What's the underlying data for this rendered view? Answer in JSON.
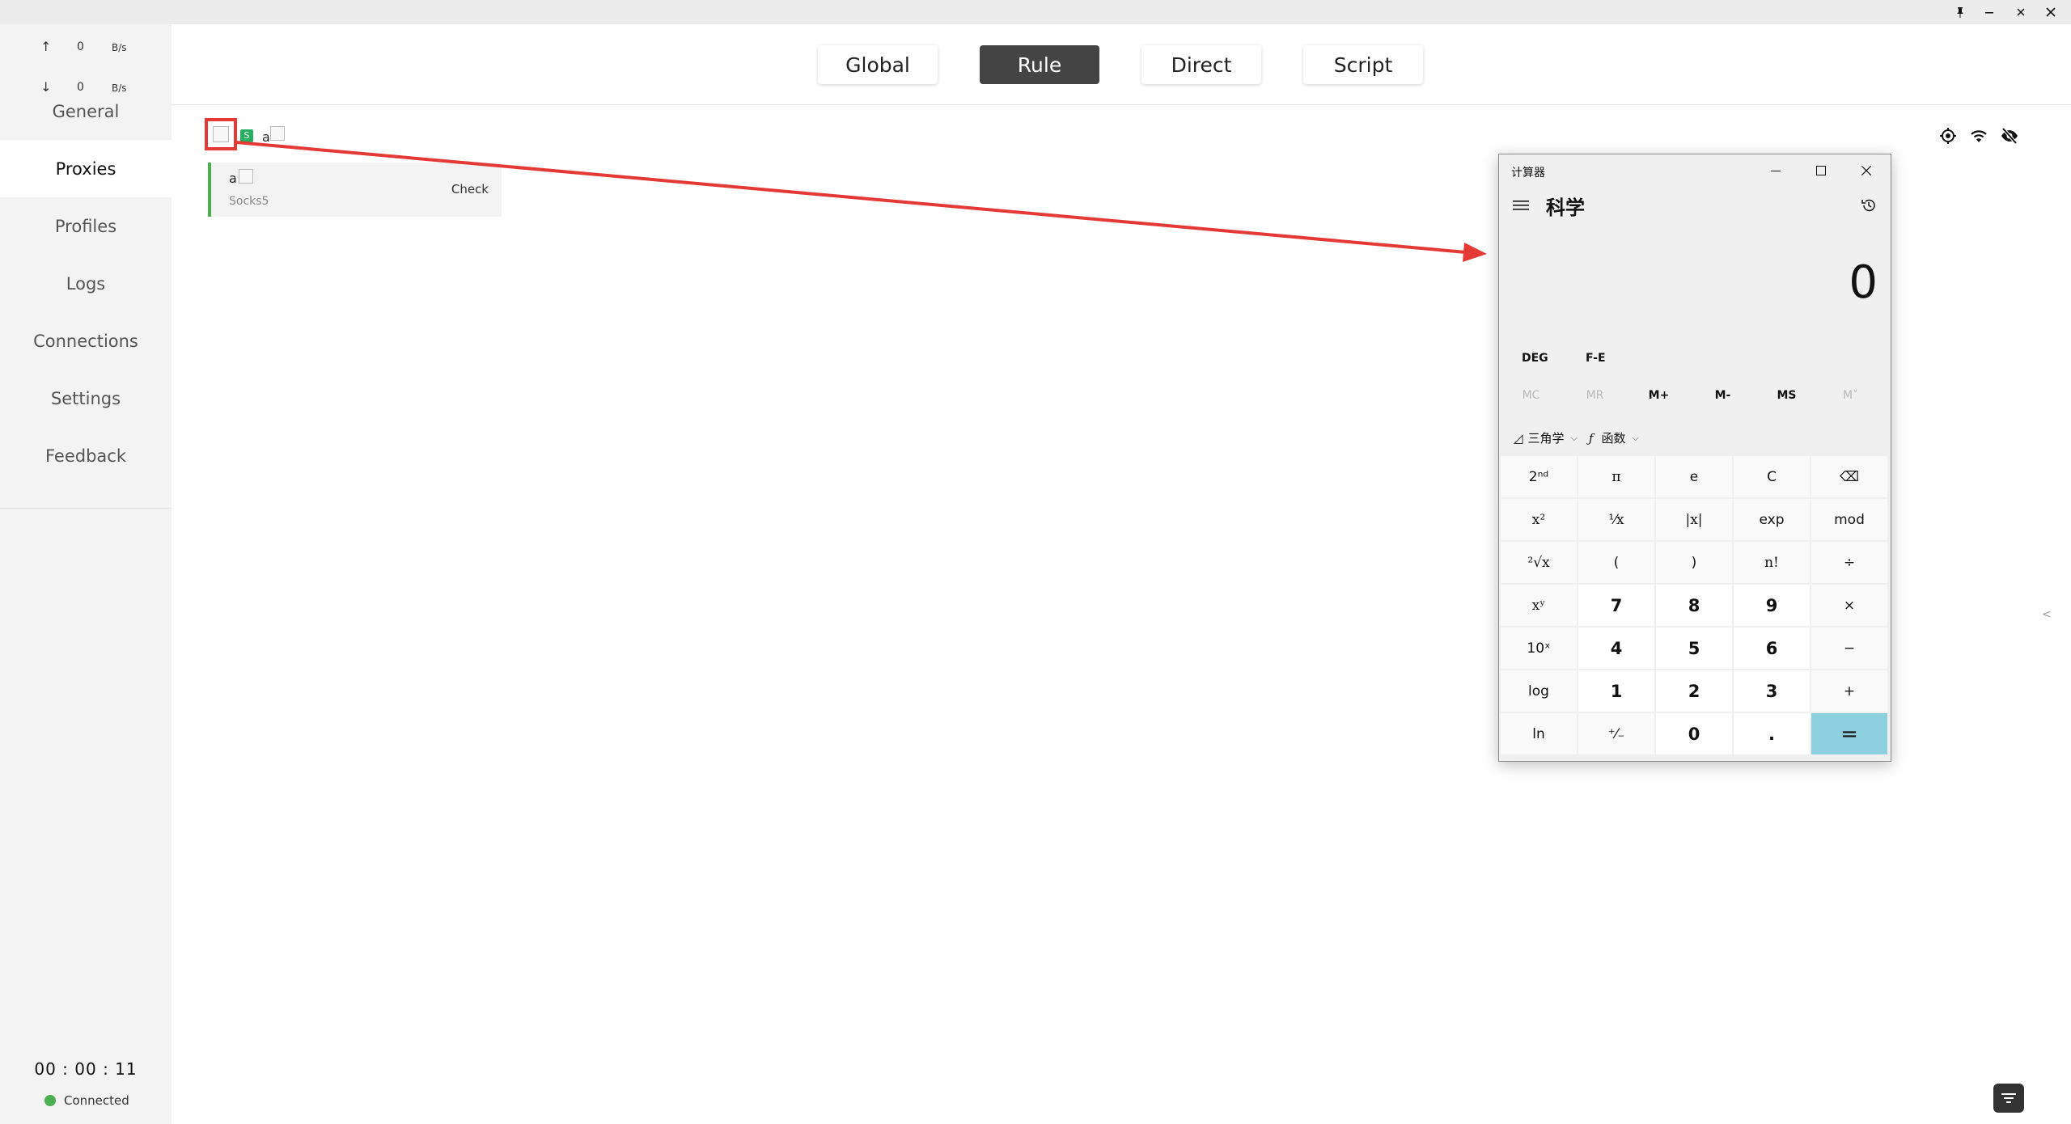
{
  "window_controls": {
    "pin": "pin-icon",
    "minimize": "minimize-icon",
    "close": "close-icon"
  },
  "traffic": {
    "upload": {
      "arrow": "↑",
      "value": "0",
      "unit": "B/s"
    },
    "download": {
      "arrow": "↓",
      "value": "0",
      "unit": "B/s"
    }
  },
  "sidebar": {
    "items": [
      {
        "label": "General"
      },
      {
        "label": "Proxies",
        "active": true
      },
      {
        "label": "Profiles"
      },
      {
        "label": "Logs"
      },
      {
        "label": "Connections"
      },
      {
        "label": "Settings"
      },
      {
        "label": "Feedback"
      }
    ],
    "timer": "00 : 00 : 11",
    "status": "Connected"
  },
  "modes": [
    {
      "label": "Global"
    },
    {
      "label": "Rule",
      "active": true
    },
    {
      "label": "Direct"
    },
    {
      "label": "Script"
    }
  ],
  "proxy_group": {
    "badge": "S",
    "name_char": "a",
    "proxy": {
      "name": "a",
      "type": "Socks5",
      "check_label": "Check"
    }
  },
  "toolbar_icons": [
    "locate-icon",
    "wifi-icon",
    "eye-off-icon"
  ],
  "calculator": {
    "title": "计算器",
    "mode": "科学",
    "display": "0",
    "options": [
      "DEG",
      "F-E"
    ],
    "memory": [
      {
        "label": "MC",
        "disabled": true
      },
      {
        "label": "MR",
        "disabled": true
      },
      {
        "label": "M+"
      },
      {
        "label": "M-"
      },
      {
        "label": "MS"
      },
      {
        "label": "M˅",
        "disabled": true
      }
    ],
    "functions": [
      {
        "icon": "◿",
        "label": "三角学"
      },
      {
        "icon": "ƒ",
        "label": "函数"
      }
    ],
    "keys": [
      {
        "label": "2ⁿᵈ",
        "cls": "txt"
      },
      {
        "label": "π"
      },
      {
        "label": "e",
        "cls": "txt"
      },
      {
        "label": "C",
        "cls": "txt"
      },
      {
        "label": "⌫",
        "cls": "txt"
      },
      {
        "label": "x²"
      },
      {
        "label": "¹⁄x"
      },
      {
        "label": "|x|"
      },
      {
        "label": "exp",
        "cls": "txt"
      },
      {
        "label": "mod",
        "cls": "txt"
      },
      {
        "label": "²√x"
      },
      {
        "label": "(",
        "cls": "txt"
      },
      {
        "label": ")",
        "cls": "txt"
      },
      {
        "label": "n!"
      },
      {
        "label": "÷",
        "cls": "txt"
      },
      {
        "label": "xʸ"
      },
      {
        "label": "7",
        "cls": "num"
      },
      {
        "label": "8",
        "cls": "num"
      },
      {
        "label": "9",
        "cls": "num"
      },
      {
        "label": "×",
        "cls": "txt"
      },
      {
        "label": "10ˣ",
        "cls": "txt"
      },
      {
        "label": "4",
        "cls": "num"
      },
      {
        "label": "5",
        "cls": "num"
      },
      {
        "label": "6",
        "cls": "num"
      },
      {
        "label": "−",
        "cls": "txt"
      },
      {
        "label": "log",
        "cls": "txt"
      },
      {
        "label": "1",
        "cls": "num"
      },
      {
        "label": "2",
        "cls": "num"
      },
      {
        "label": "3",
        "cls": "num"
      },
      {
        "label": "+",
        "cls": "txt"
      },
      {
        "label": "ln",
        "cls": "txt"
      },
      {
        "label": "⁺⁄₋",
        "cls": "txt"
      },
      {
        "label": "0",
        "cls": "num"
      },
      {
        "label": ".",
        "cls": "num"
      },
      {
        "label": "=",
        "cls": "eq"
      }
    ]
  },
  "side_chevron": "<"
}
